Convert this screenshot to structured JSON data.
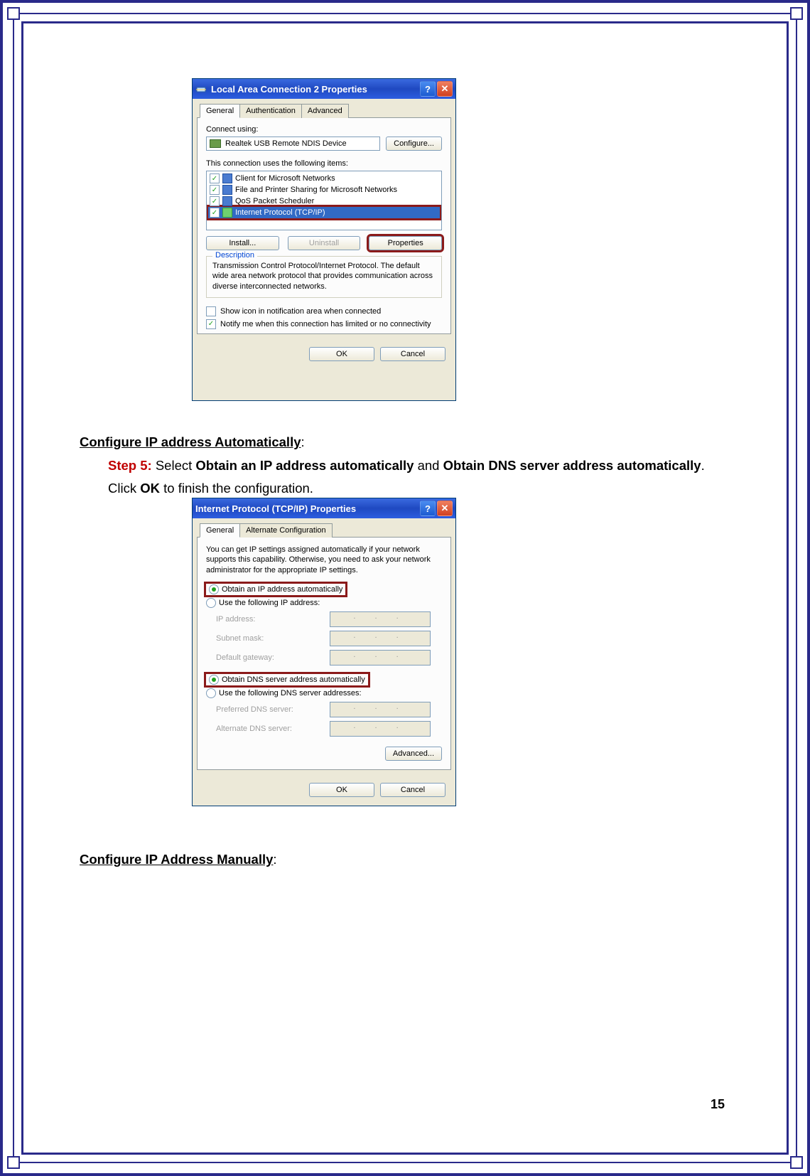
{
  "page_number": "15",
  "dialog1": {
    "title": "Local Area Connection 2 Properties",
    "tabs": [
      "General",
      "Authentication",
      "Advanced"
    ],
    "connect_using_label": "Connect using:",
    "adapter": "Realtek USB Remote NDIS Device",
    "configure_btn": "Configure...",
    "items_label": "This connection uses the following items:",
    "items": [
      "Client for Microsoft Networks",
      "File and Printer Sharing for Microsoft Networks",
      "QoS Packet Scheduler",
      "Internet Protocol (TCP/IP)"
    ],
    "install_btn": "Install...",
    "uninstall_btn": "Uninstall",
    "properties_btn": "Properties",
    "desc_legend": "Description",
    "desc_text": "Transmission Control Protocol/Internet Protocol. The default wide area network protocol that provides communication across diverse interconnected networks.",
    "show_icon": "Show icon in notification area when connected",
    "notify": "Notify me when this connection has limited or no connectivity",
    "ok_btn": "OK",
    "cancel_btn": "Cancel"
  },
  "section1": {
    "heading": "Configure IP address Automatically",
    "step_label": "Step 5:",
    "text_a": " Select ",
    "bold1": "Obtain an IP address automatically",
    "text_b": " and ",
    "bold2": "Obtain DNS server address automatically",
    "text_c": ". Click ",
    "bold3": "OK",
    "text_d": " to finish the configuration."
  },
  "dialog2": {
    "title": "Internet Protocol (TCP/IP) Properties",
    "tabs": [
      "General",
      "Alternate Configuration"
    ],
    "intro": "You can get IP settings assigned automatically if your network supports this capability. Otherwise, you need to ask your network administrator for the appropriate IP settings.",
    "radio_auto_ip": "Obtain an IP address automatically",
    "radio_manual_ip": "Use the following IP address:",
    "ip_address": "IP address:",
    "subnet_mask": "Subnet mask:",
    "default_gateway": "Default gateway:",
    "radio_auto_dns": "Obtain DNS server address automatically",
    "radio_manual_dns": "Use the following DNS server addresses:",
    "preferred_dns": "Preferred DNS server:",
    "alternate_dns": "Alternate DNS server:",
    "advanced_btn": "Advanced...",
    "ok_btn": "OK",
    "cancel_btn": "Cancel"
  },
  "section2": {
    "heading": "Configure IP Address Manually"
  }
}
